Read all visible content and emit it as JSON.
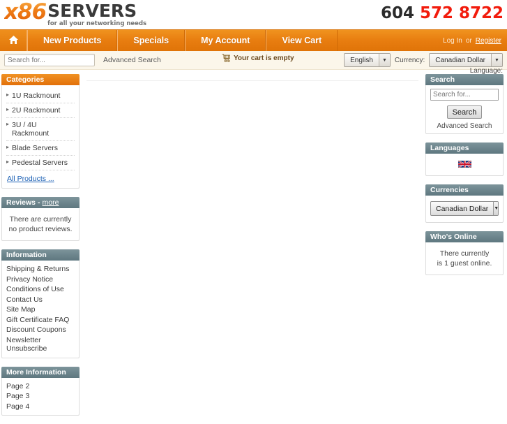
{
  "header": {
    "logo_mark": "x86",
    "logo_name": "SERVERS",
    "logo_tagline": "for all your networking needs",
    "phone_area": "604",
    "phone_number": "572 8722"
  },
  "nav": {
    "home_icon": "home-icon",
    "items": [
      {
        "label": "New Products"
      },
      {
        "label": "Specials"
      },
      {
        "label": "My Account"
      },
      {
        "label": "View Cart"
      }
    ],
    "login_label": "Log In",
    "or_label": "or",
    "register_label": "Register"
  },
  "utility": {
    "search_placeholder": "Search for...",
    "search_value": "",
    "search_go_icon": "play-arrow-icon",
    "advanced_search_label": "Advanced Search",
    "cart_icon": "shopping-cart-icon",
    "cart_status": "Your cart is empty",
    "language_value": "English",
    "currency_label": "Currency:",
    "currency_value": "Canadian Dollar",
    "language_label": "Language:"
  },
  "sidebar_left": {
    "categories": {
      "title": "Categories",
      "items": [
        {
          "label": "1U Rackmount"
        },
        {
          "label": "2U Rackmount"
        },
        {
          "label": "3U / 4U Rackmount"
        },
        {
          "label": "Blade Servers"
        },
        {
          "label": "Pedestal Servers"
        }
      ],
      "all_products_label": "All Products ..."
    },
    "reviews": {
      "title": "Reviews",
      "separator": "-",
      "more_label": "more",
      "empty_text": "There are currently no product reviews."
    },
    "information": {
      "title": "Information",
      "items": [
        {
          "label": "Shipping & Returns"
        },
        {
          "label": "Privacy Notice"
        },
        {
          "label": "Conditions of Use"
        },
        {
          "label": "Contact Us"
        },
        {
          "label": "Site Map"
        },
        {
          "label": "Gift Certificate FAQ"
        },
        {
          "label": "Discount Coupons"
        },
        {
          "label": "Newsletter Unsubscribe"
        }
      ]
    },
    "more_information": {
      "title": "More Information",
      "items": [
        {
          "label": "Page 2"
        },
        {
          "label": "Page 3"
        },
        {
          "label": "Page 4"
        }
      ]
    }
  },
  "sidebar_right": {
    "search": {
      "title": "Search",
      "input_placeholder": "Search for...",
      "input_value": "",
      "button_label": "Search",
      "advanced_label": "Advanced Search"
    },
    "languages": {
      "title": "Languages",
      "flag_icon": "uk-flag-icon",
      "flag_alt": "English"
    },
    "currencies": {
      "title": "Currencies",
      "selected": "Canadian Dollar"
    },
    "whos_online": {
      "title": "Who's Online",
      "line1": "There currently",
      "line2": "is 1 guest online."
    }
  },
  "colors": {
    "brand_orange": "#e8800f",
    "phone_red": "#f21b0c",
    "slate_header": "#5e777f",
    "util_bg": "#fbf6ea",
    "link_blue": "#1a5fb4"
  }
}
